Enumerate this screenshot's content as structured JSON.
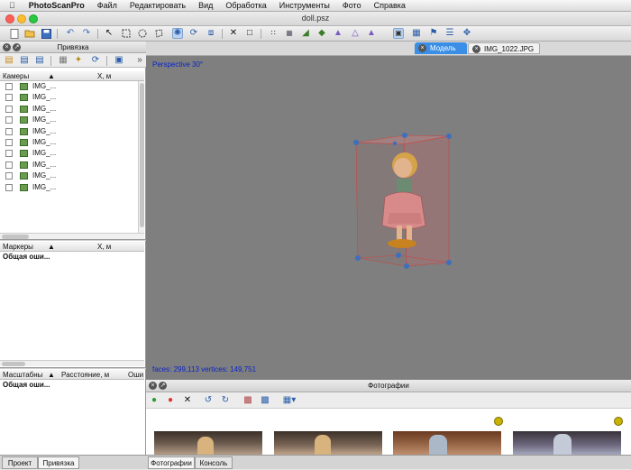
{
  "menubar": {
    "app_name": "PhotoScanPro",
    "items": [
      "Файл",
      "Редактировать",
      "Вид",
      "Обработка",
      "Инструменты",
      "Фото",
      "Справка"
    ]
  },
  "window": {
    "title": "doll.psz"
  },
  "left_panel": {
    "title": "Привязка",
    "cameras": {
      "col_name": "Камеры",
      "col_x": "X, м",
      "rows": [
        "IMG_...",
        "IMG_...",
        "IMG_...",
        "IMG_...",
        "IMG_...",
        "IMG_...",
        "IMG_...",
        "IMG_...",
        "IMG_...",
        "IMG_..."
      ]
    },
    "markers": {
      "col_name": "Маркеры",
      "col_x": "X, м",
      "total_label": "Общая оши..."
    },
    "scalebars": {
      "col_name": "Масштабны",
      "col_dist": "Расстояние, м",
      "col_err": "Оши",
      "total_label": "Общая оши..."
    },
    "bottom_tabs": [
      "Проект",
      "Привязка"
    ]
  },
  "view_tabs": [
    "Модель",
    "IMG_1022.JPG"
  ],
  "viewport": {
    "projection_label": "Perspective 30°",
    "stats_label": "faces: 299,113 vertices: 149,751"
  },
  "photos_panel": {
    "title": "Фотографии",
    "bottom_tabs": [
      "Фотографии",
      "Консоль"
    ]
  },
  "colors": {
    "accent": "#3a8ee6",
    "viewport_bg": "#7f7f7f",
    "viewport_text": "#0a24c8",
    "bbox_handle": "#3d6fbd"
  },
  "icons": [
    "apple-icon",
    "new-icon",
    "open-icon",
    "save-icon",
    "undo-icon",
    "redo-icon",
    "pointer-icon",
    "rect-select-icon",
    "circle-select-icon",
    "free-select-icon",
    "navigation-icon",
    "rotate-object-icon",
    "resize-region-icon",
    "delete-icon",
    "crop-icon",
    "point-cloud-icon",
    "dense-cloud-icon",
    "mesh-icon",
    "texture-icon",
    "shaded-icon",
    "wireframe-icon",
    "camera-icon",
    "marker-icon",
    "flag-icon",
    "align-icon",
    "move-icon"
  ]
}
